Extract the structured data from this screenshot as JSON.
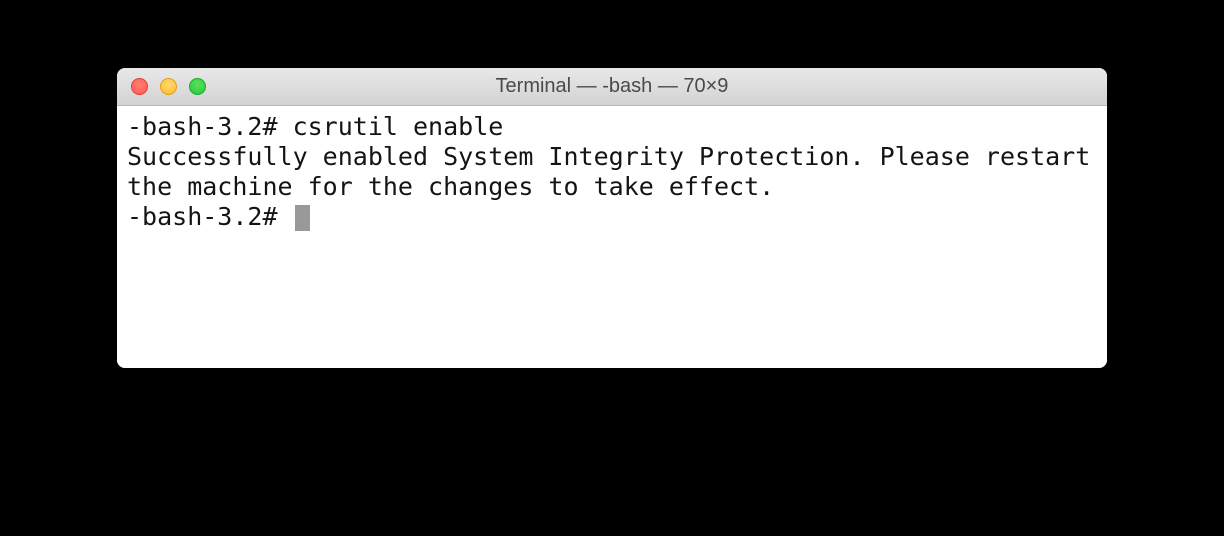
{
  "window": {
    "title": "Terminal — -bash — 70×9"
  },
  "terminal": {
    "line1_prompt": "-bash-3.2# ",
    "line1_command": "csrutil enable",
    "output": "Successfully enabled System Integrity Protection. Please restart the machine for the changes to take effect.",
    "line2_prompt": "-bash-3.2# "
  }
}
